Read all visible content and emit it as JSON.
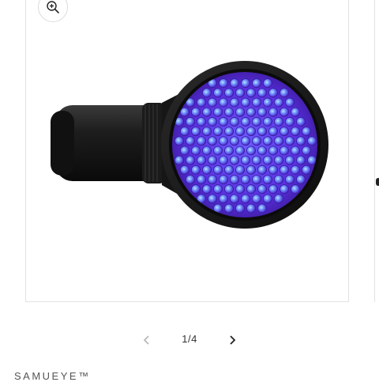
{
  "gallery": {
    "current": "1",
    "total": "4",
    "separator": "/",
    "zoom_icon": "zoom-in-icon",
    "prev_icon": "chevron-left-icon",
    "next_icon": "chevron-right-icon"
  },
  "product": {
    "vendor": "SAMUEYE™",
    "image": "uv-flashlight-product-photo"
  },
  "colors": {
    "led_glow": "#6f4cff",
    "led_core": "#8fd0ff",
    "body_black": "#141414",
    "border": "#e3e3e3"
  }
}
